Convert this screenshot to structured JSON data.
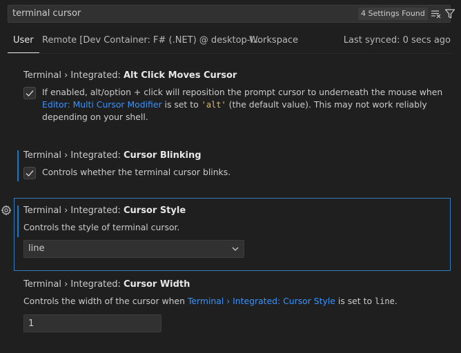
{
  "search": {
    "query": "terminal cursor",
    "result_count": "4 Settings Found"
  },
  "tabs": [
    {
      "label": "User"
    },
    {
      "label": "Remote [Dev Container: F# (.NET) @ desktop-l..."
    },
    {
      "label": "Workspace"
    }
  ],
  "sync_status": "Last synced: 0 secs ago",
  "settings": {
    "alt_click": {
      "prefix": "Terminal › Integrated: ",
      "name": "Alt Click Moves Cursor",
      "desc_before": "If enabled, alt/option + click will reposition the prompt cursor to underneath the mouse when ",
      "desc_link": "Editor: Multi Cursor Modifier",
      "desc_mid": " is set to ",
      "desc_code": "'alt'",
      "desc_after": " (the default value). This may not work reliably depending on your shell.",
      "checked": true
    },
    "blinking": {
      "prefix": "Terminal › Integrated: ",
      "name": "Cursor Blinking",
      "desc": "Controls whether the terminal cursor blinks.",
      "checked": true
    },
    "style": {
      "prefix": "Terminal › Integrated: ",
      "name": "Cursor Style",
      "desc": "Controls the style of terminal cursor.",
      "value": "line"
    },
    "width": {
      "prefix": "Terminal › Integrated: ",
      "name": "Cursor Width",
      "desc_before": "Controls the width of the cursor when ",
      "desc_link": "Terminal › Integrated: Cursor Style",
      "desc_mid": " is set to ",
      "desc_code": "line",
      "desc_after": ".",
      "value": "1"
    }
  },
  "colors": {
    "accent": "#0b7ad1",
    "link": "#3794ff",
    "focus_border": "#2f7ec2"
  }
}
